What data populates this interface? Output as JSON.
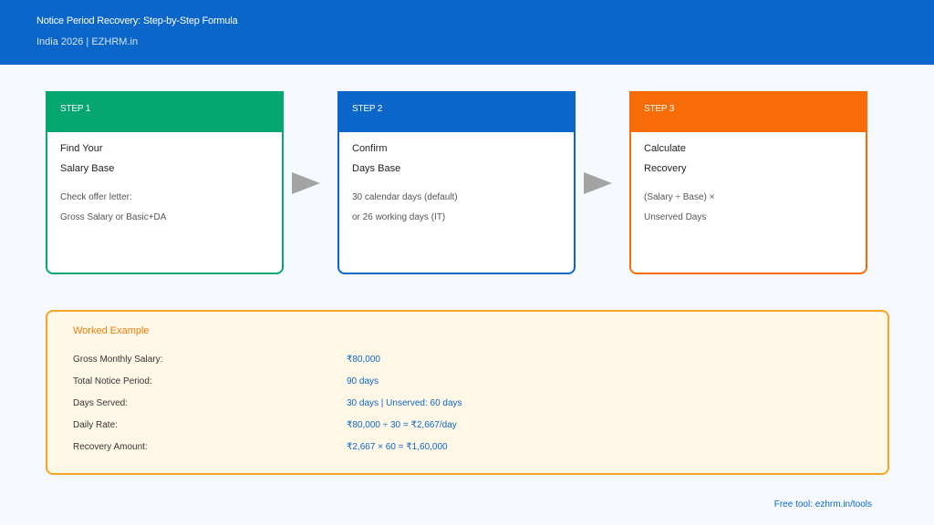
{
  "header": {
    "title": "Notice Period Recovery: Step-by-Step Formula",
    "subtitle": "India 2026 | EZHRM.in"
  },
  "colors": {
    "header_bg": "#0b66c9",
    "step1": "#05a66f",
    "step2": "#0b66c9",
    "step3": "#f76c07",
    "arrow": "#a3a3a3",
    "example_border": "#f6a623",
    "example_bg": "#fff8e7",
    "value_text": "#0b66c9"
  },
  "steps": [
    {
      "label": "STEP 1",
      "title_line1": "Find Your",
      "title_line2": "Salary Base",
      "desc_line1": "Check offer letter:",
      "desc_line2": "Gross Salary or Basic+DA"
    },
    {
      "label": "STEP 2",
      "title_line1": "Confirm",
      "title_line2": "Days Base",
      "desc_line1": "30 calendar days (default)",
      "desc_line2": "or 26 working days (IT)"
    },
    {
      "label": "STEP 3",
      "title_line1": "Calculate",
      "title_line2": "Recovery",
      "desc_line1": "(Salary ÷ Base) ×",
      "desc_line2": "Unserved Days"
    }
  ],
  "example": {
    "title": "Worked Example",
    "rows": [
      {
        "label": "Gross Monthly Salary:",
        "value": "₹80,000"
      },
      {
        "label": "Total Notice Period:",
        "value": "90 days"
      },
      {
        "label": "Days Served:",
        "value": "30 days | Unserved: 60 days"
      },
      {
        "label": "Daily Rate:",
        "value": "₹80,000 ÷ 30 = ₹2,667/day"
      },
      {
        "label": "Recovery Amount:",
        "value": "₹2,667 × 60 = ₹1,60,000"
      }
    ]
  },
  "footer": {
    "text": "Free tool: ezhrm.in/tools"
  }
}
